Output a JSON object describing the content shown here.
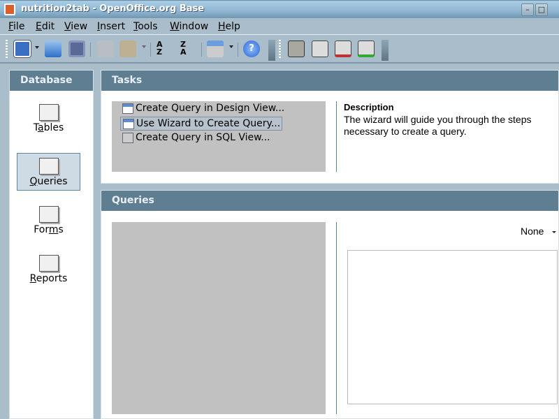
{
  "window": {
    "title": "nutrition2tab - OpenOffice.org Base",
    "minimize": "–",
    "maximize": "□"
  },
  "menu": [
    {
      "key": "F",
      "rest": "ile"
    },
    {
      "key": "E",
      "rest": "dit"
    },
    {
      "key": "V",
      "rest": "iew"
    },
    {
      "key": "I",
      "rest": "nsert"
    },
    {
      "key": "T",
      "rest": "ools"
    },
    {
      "key": "W",
      "rest": "indow"
    },
    {
      "key": "H",
      "rest": "elp"
    }
  ],
  "toolbar": {
    "icons": [
      "new-document-icon",
      "open-folder-icon",
      "save-icon",
      "copy-icon",
      "paste-icon",
      "sort-ascending-icon",
      "sort-descending-icon",
      "database-objects-icon",
      "help-icon",
      "open-database-object-icon",
      "edit-icon",
      "delete-icon",
      "rename-icon"
    ]
  },
  "sidebar": {
    "title": "Database",
    "items": [
      {
        "pre": "T",
        "key": "a",
        "post": "bles"
      },
      {
        "pre": "",
        "key": "Q",
        "post": "ueries",
        "selected": true
      },
      {
        "pre": "For",
        "key": "m",
        "post": "s"
      },
      {
        "pre": "",
        "key": "R",
        "post": "eports"
      }
    ]
  },
  "tasks": {
    "title": "Tasks",
    "items": [
      "Create Query in Design View...",
      "Use Wizard to Create Query...",
      "Create Query in SQL View..."
    ],
    "selected_index": 1,
    "description_title": "Description",
    "description": "The wizard will guide you through the steps necessary to create a query."
  },
  "queries": {
    "title": "Queries",
    "preview_mode": "None"
  },
  "colors": {
    "header": "#5f7e92",
    "background": "#a9bdcb",
    "list": "#c1c1c1"
  }
}
